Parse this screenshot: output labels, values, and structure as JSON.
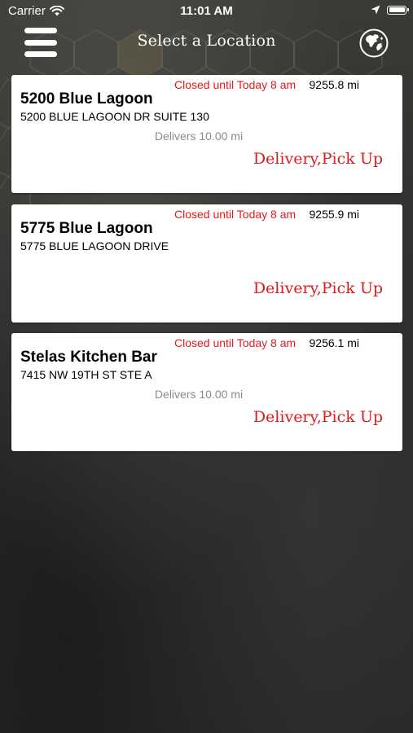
{
  "status_bar": {
    "carrier": "Carrier",
    "time": "11:01 AM"
  },
  "nav": {
    "title": "Select a Location",
    "menu_icon": "hamburger-menu-icon",
    "globe_icon": "globe-icon"
  },
  "colors": {
    "status_red": "#e01b1b",
    "delivers_gray": "#8a8a8a",
    "card_background": "#ffffff"
  },
  "locations": [
    {
      "status": "Closed until Today 8 am",
      "distance": "9255.8 mi",
      "name": "5200 Blue Lagoon",
      "address": "5200 BLUE LAGOON DR SUITE 130",
      "delivers": "Delivers 10.00 mi",
      "services": "Delivery,Pick Up"
    },
    {
      "status": "Closed until Today 8 am",
      "distance": "9255.9 mi",
      "name": "5775 Blue Lagoon",
      "address": "5775 BLUE LAGOON DRIVE",
      "delivers": "",
      "services": "Delivery,Pick Up"
    },
    {
      "status": "Closed until Today 8 am",
      "distance": "9256.1 mi",
      "name": "Stelas Kitchen Bar",
      "address": "7415 NW 19TH ST STE A",
      "delivers": "Delivers 10.00 mi",
      "services": "Delivery,Pick Up"
    }
  ]
}
